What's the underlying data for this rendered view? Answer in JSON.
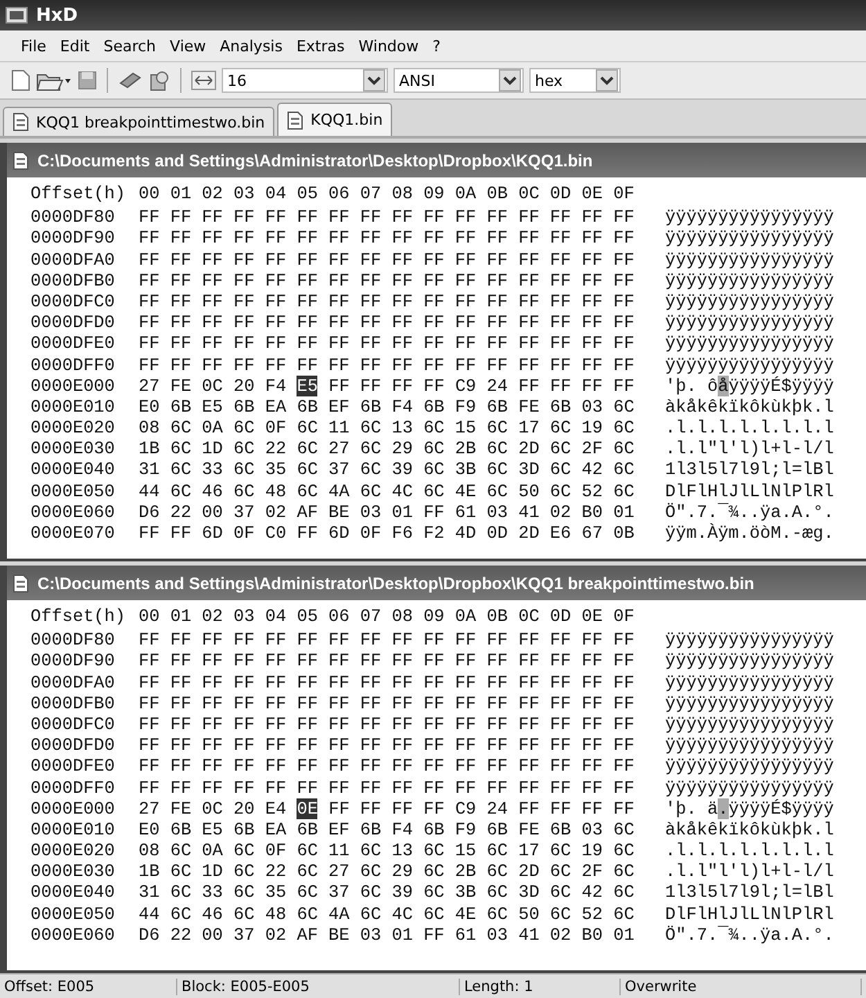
{
  "window": {
    "title": "HxD"
  },
  "menu": [
    "File",
    "Edit",
    "Search",
    "View",
    "Analysis",
    "Extras",
    "Window",
    "?"
  ],
  "toolbar": {
    "bytes_per_row": "16",
    "charset": "ANSI",
    "offset_base": "hex"
  },
  "tabs": [
    {
      "label": "KQQ1 breakpointtimestwo.bin",
      "selected": false
    },
    {
      "label": "KQQ1.bin",
      "selected": true
    }
  ],
  "panes": [
    {
      "path": "C:\\Documents and Settings\\Administrator\\Desktop\\Dropbox\\KQQ1.bin",
      "header_label": "Offset(h)",
      "header_columns": "00 01 02 03 04 05 06 07 08 09 0A 0B 0C 0D 0E 0F",
      "rows": [
        {
          "kind": "plain",
          "offset": "0000DF80",
          "bytes": "FF FF FF FF FF FF FF FF FF FF FF FF FF FF FF FF",
          "text": "ÿÿÿÿÿÿÿÿÿÿÿÿÿÿÿÿ"
        },
        {
          "kind": "plain",
          "offset": "0000DF90",
          "bytes": "FF FF FF FF FF FF FF FF FF FF FF FF FF FF FF FF",
          "text": "ÿÿÿÿÿÿÿÿÿÿÿÿÿÿÿÿ"
        },
        {
          "kind": "plain",
          "offset": "0000DFA0",
          "bytes": "FF FF FF FF FF FF FF FF FF FF FF FF FF FF FF FF",
          "text": "ÿÿÿÿÿÿÿÿÿÿÿÿÿÿÿÿ"
        },
        {
          "kind": "plain",
          "offset": "0000DFB0",
          "bytes": "FF FF FF FF FF FF FF FF FF FF FF FF FF FF FF FF",
          "text": "ÿÿÿÿÿÿÿÿÿÿÿÿÿÿÿÿ"
        },
        {
          "kind": "plain",
          "offset": "0000DFC0",
          "bytes": "FF FF FF FF FF FF FF FF FF FF FF FF FF FF FF FF",
          "text": "ÿÿÿÿÿÿÿÿÿÿÿÿÿÿÿÿ"
        },
        {
          "kind": "plain",
          "offset": "0000DFD0",
          "bytes": "FF FF FF FF FF FF FF FF FF FF FF FF FF FF FF FF",
          "text": "ÿÿÿÿÿÿÿÿÿÿÿÿÿÿÿÿ"
        },
        {
          "kind": "plain",
          "offset": "0000DFE0",
          "bytes": "FF FF FF FF FF FF FF FF FF FF FF FF FF FF FF FF",
          "text": "ÿÿÿÿÿÿÿÿÿÿÿÿÿÿÿÿ"
        },
        {
          "kind": "plain",
          "offset": "0000DFF0",
          "bytes": "FF FF FF FF FF FF FF FF FF FF FF FF FF FF FF FF",
          "text": "ÿÿÿÿÿÿÿÿÿÿÿÿÿÿÿÿ"
        },
        {
          "kind": "cursor",
          "offset": "0000E000",
          "bytes_before": "27 FE 0C 20 F4",
          "byte_at": "E5",
          "bytes_after": "FF FF FF FF C9 24 FF FF FF FF",
          "text_before": "'þ. ô",
          "text_at": "å",
          "text_after": "ÿÿÿÿÉ$ÿÿÿÿ"
        },
        {
          "kind": "plain",
          "offset": "0000E010",
          "bytes": "E0 6B E5 6B EA 6B EF 6B F4 6B F9 6B FE 6B 03 6C",
          "text": "àkåkêkïkôkùkþk.l"
        },
        {
          "kind": "plain",
          "offset": "0000E020",
          "bytes": "08 6C 0A 6C 0F 6C 11 6C 13 6C 15 6C 17 6C 19 6C",
          "text": ".l.l.l.l.l.l.l.l"
        },
        {
          "kind": "plain",
          "offset": "0000E030",
          "bytes": "1B 6C 1D 6C 22 6C 27 6C 29 6C 2B 6C 2D 6C 2F 6C",
          "text": ".l.l\"l'l)l+l-l/l"
        },
        {
          "kind": "plain",
          "offset": "0000E040",
          "bytes": "31 6C 33 6C 35 6C 37 6C 39 6C 3B 6C 3D 6C 42 6C",
          "text": "1l3l5l7l9l;l=lBl"
        },
        {
          "kind": "plain",
          "offset": "0000E050",
          "bytes": "44 6C 46 6C 48 6C 4A 6C 4C 6C 4E 6C 50 6C 52 6C",
          "text": "DlFlHlJlLlNlPlRl"
        },
        {
          "kind": "plain",
          "offset": "0000E060",
          "bytes": "D6 22 00 37 02 AF BE 03 01 FF 61 03 41 02 B0 01",
          "text": "Ö\".7.¯¾..ÿa.A.°."
        },
        {
          "kind": "plain",
          "offset": "0000E070",
          "bytes": "FF FF 6D 0F C0 FF 6D 0F F6 F2 4D 0D 2D E6 67 0B",
          "text": "ÿÿm.Àÿm.öòM.-æg."
        }
      ]
    },
    {
      "path": "C:\\Documents and Settings\\Administrator\\Desktop\\Dropbox\\KQQ1 breakpointtimestwo.bin",
      "header_label": "Offset(h)",
      "header_columns": "00 01 02 03 04 05 06 07 08 09 0A 0B 0C 0D 0E 0F",
      "rows": [
        {
          "kind": "plain",
          "offset": "0000DF80",
          "bytes": "FF FF FF FF FF FF FF FF FF FF FF FF FF FF FF FF",
          "text": "ÿÿÿÿÿÿÿÿÿÿÿÿÿÿÿÿ"
        },
        {
          "kind": "plain",
          "offset": "0000DF90",
          "bytes": "FF FF FF FF FF FF FF FF FF FF FF FF FF FF FF FF",
          "text": "ÿÿÿÿÿÿÿÿÿÿÿÿÿÿÿÿ"
        },
        {
          "kind": "plain",
          "offset": "0000DFA0",
          "bytes": "FF FF FF FF FF FF FF FF FF FF FF FF FF FF FF FF",
          "text": "ÿÿÿÿÿÿÿÿÿÿÿÿÿÿÿÿ"
        },
        {
          "kind": "plain",
          "offset": "0000DFB0",
          "bytes": "FF FF FF FF FF FF FF FF FF FF FF FF FF FF FF FF",
          "text": "ÿÿÿÿÿÿÿÿÿÿÿÿÿÿÿÿ"
        },
        {
          "kind": "plain",
          "offset": "0000DFC0",
          "bytes": "FF FF FF FF FF FF FF FF FF FF FF FF FF FF FF FF",
          "text": "ÿÿÿÿÿÿÿÿÿÿÿÿÿÿÿÿ"
        },
        {
          "kind": "plain",
          "offset": "0000DFD0",
          "bytes": "FF FF FF FF FF FF FF FF FF FF FF FF FF FF FF FF",
          "text": "ÿÿÿÿÿÿÿÿÿÿÿÿÿÿÿÿ"
        },
        {
          "kind": "plain",
          "offset": "0000DFE0",
          "bytes": "FF FF FF FF FF FF FF FF FF FF FF FF FF FF FF FF",
          "text": "ÿÿÿÿÿÿÿÿÿÿÿÿÿÿÿÿ"
        },
        {
          "kind": "plain",
          "offset": "0000DFF0",
          "bytes": "FF FF FF FF FF FF FF FF FF FF FF FF FF FF FF FF",
          "text": "ÿÿÿÿÿÿÿÿÿÿÿÿÿÿÿÿ"
        },
        {
          "kind": "cursor",
          "offset": "0000E000",
          "bytes_before": "27 FE 0C 20 E4",
          "byte_at": "0E",
          "bytes_after": "FF FF FF FF C9 24 FF FF FF FF",
          "text_before": "'þ. ä",
          "text_at": ".",
          "text_after": "ÿÿÿÿÉ$ÿÿÿÿ"
        },
        {
          "kind": "plain",
          "offset": "0000E010",
          "bytes": "E0 6B E5 6B EA 6B EF 6B F4 6B F9 6B FE 6B 03 6C",
          "text": "àkåkêkïkôkùkþk.l"
        },
        {
          "kind": "plain",
          "offset": "0000E020",
          "bytes": "08 6C 0A 6C 0F 6C 11 6C 13 6C 15 6C 17 6C 19 6C",
          "text": ".l.l.l.l.l.l.l.l"
        },
        {
          "kind": "plain",
          "offset": "0000E030",
          "bytes": "1B 6C 1D 6C 22 6C 27 6C 29 6C 2B 6C 2D 6C 2F 6C",
          "text": ".l.l\"l'l)l+l-l/l"
        },
        {
          "kind": "plain",
          "offset": "0000E040",
          "bytes": "31 6C 33 6C 35 6C 37 6C 39 6C 3B 6C 3D 6C 42 6C",
          "text": "1l3l5l7l9l;l=lBl"
        },
        {
          "kind": "plain",
          "offset": "0000E050",
          "bytes": "44 6C 46 6C 48 6C 4A 6C 4C 6C 4E 6C 50 6C 52 6C",
          "text": "DlFlHlJlLlNlPlRl"
        },
        {
          "kind": "plain",
          "offset": "0000E060",
          "bytes": "D6 22 00 37 02 AF BE 03 01 FF 61 03 41 02 B0 01",
          "text": "Ö\".7.¯¾..ÿa.A.°."
        }
      ]
    }
  ],
  "status_bar": {
    "offset": "Offset: E005",
    "block": "Block: E005-E005",
    "length": "Length: 1",
    "mode": "Overwrite"
  }
}
